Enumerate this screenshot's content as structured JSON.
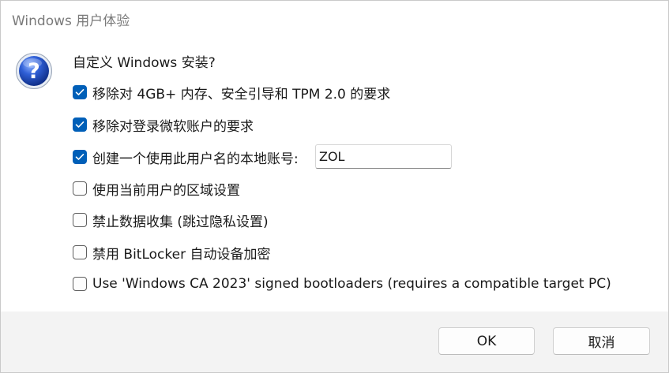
{
  "window": {
    "title": "Windows 用户体验"
  },
  "icon": "help-question-icon",
  "question": "自定义 Windows 安装?",
  "options": [
    {
      "label": "移除对 4GB+ 内存、安全引导和 TPM 2.0 的要求",
      "checked": true
    },
    {
      "label": "移除对登录微软账户的要求",
      "checked": true
    },
    {
      "label": "创建一个使用此用户名的本地账号:",
      "checked": true
    },
    {
      "label": "使用当前用户的区域设置",
      "checked": false
    },
    {
      "label": "禁止数据收集 (跳过隐私设置)",
      "checked": false
    },
    {
      "label": "禁用 BitLocker 自动设备加密",
      "checked": false
    },
    {
      "label": "Use 'Windows CA 2023' signed bootloaders (requires a compatible target PC)",
      "checked": false
    }
  ],
  "username": {
    "value": "ZOL"
  },
  "buttons": {
    "ok": "OK",
    "cancel": "取消"
  },
  "colors": {
    "accent": "#005fb8",
    "footer": "#f3f3f3",
    "title_text": "#7a7a7a"
  }
}
